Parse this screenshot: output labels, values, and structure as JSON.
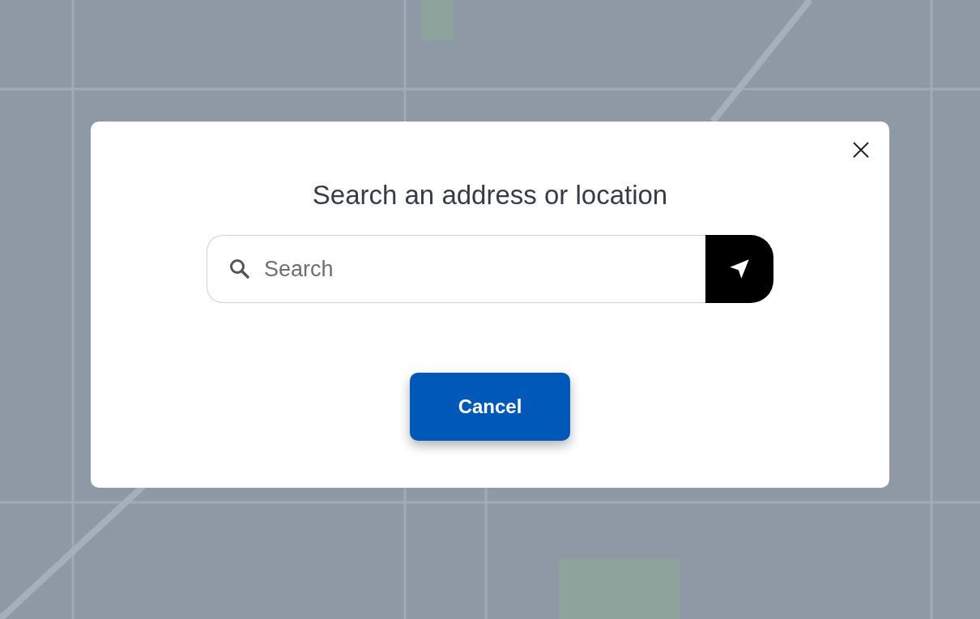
{
  "dialog": {
    "title": "Search an address or location",
    "search": {
      "placeholder": "Search"
    },
    "cancel_button": "Cancel"
  }
}
